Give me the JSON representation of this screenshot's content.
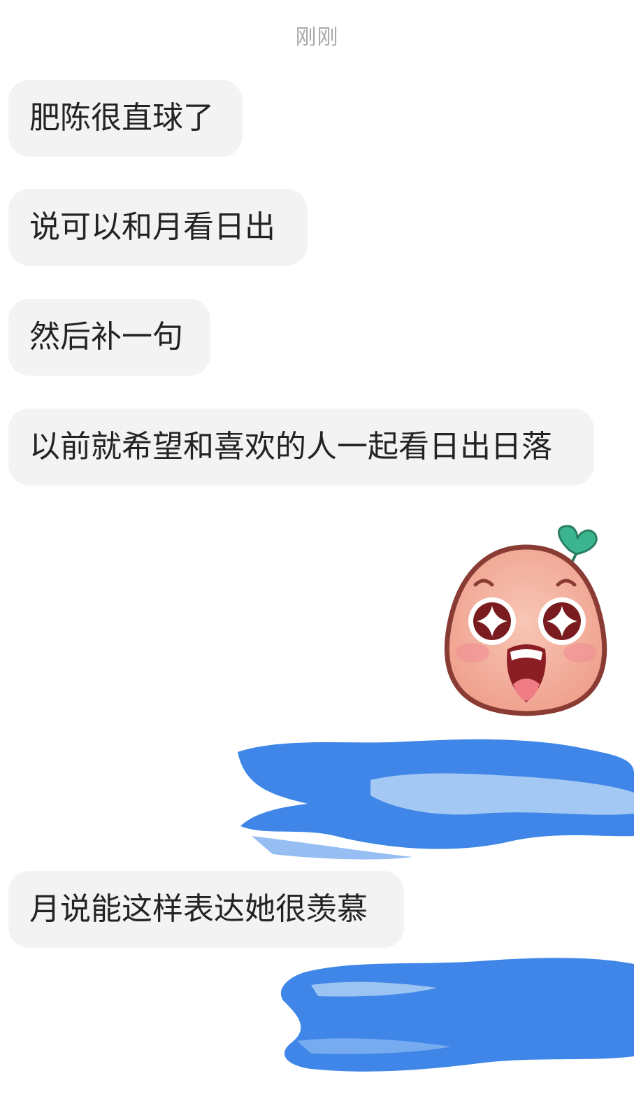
{
  "chat": {
    "timestamp": "刚刚",
    "messages": [
      {
        "text": "肥陈很直球了"
      },
      {
        "text": "说可以和月看日出"
      },
      {
        "text": "然后补一句"
      },
      {
        "text": "以前就希望和喜欢的人一起看日出日落"
      },
      {
        "text": "月说能这样表达她很羡慕"
      }
    ],
    "sticker": {
      "icon": "star-eyes-peach-face-icon"
    },
    "redactions": [
      {
        "color": "#3f86e8"
      },
      {
        "color": "#3f86e8"
      }
    ]
  },
  "colors": {
    "background": "#ffffff",
    "bubble": "#f3f3f3",
    "text": "#232323",
    "timestamp": "#a9a9a9",
    "sticker_face": "#f3b1a0",
    "sticker_outline": "#8a3b33",
    "sticker_leaf": "#3bb58f",
    "redaction": "#3f86e8"
  }
}
